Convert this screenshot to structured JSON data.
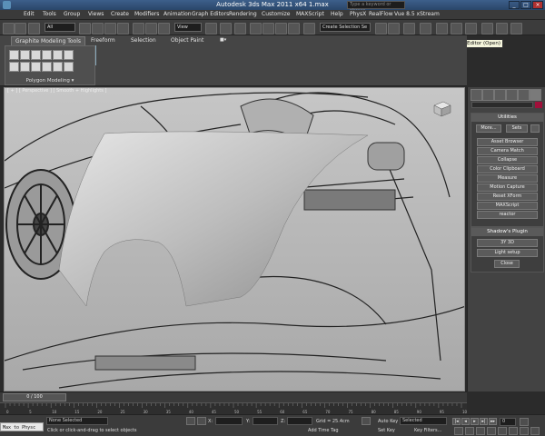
{
  "window": {
    "title": "Autodesk 3ds Max 2011 x64      1.max",
    "search_placeholder": "Type a keyword or phrase",
    "minimize": "_",
    "maximize": "□",
    "close": "×"
  },
  "menu": {
    "items": [
      "Edit",
      "Tools",
      "Group",
      "Views",
      "Create",
      "Modifiers",
      "Animation",
      "Graph Editors",
      "Rendering",
      "Customize",
      "MAXScript",
      "Help",
      "PhysX",
      "RealFlow",
      "Vue 8.5 xStream"
    ]
  },
  "toolbar": {
    "selection_filter": "All",
    "ref_coord": "View",
    "named_selection": "Create Selection Se",
    "tooltip": "Curve Editor (Open)"
  },
  "ribbon": {
    "tabs": [
      "Graphite Modeling Tools",
      "Freeform",
      "Selection",
      "Object Paint"
    ],
    "panel_label": "Polygon Modeling ▾"
  },
  "viewport": {
    "label": "[ + ] [ Perspective ] [ Smooth + Highlights ]"
  },
  "command_panel": {
    "utilities_title": "Utilities",
    "more_label": "More...",
    "sets_label": "Sets",
    "utility_buttons": [
      "Asset Browser",
      "Camera Match",
      "Collapse",
      "Color Clipboard",
      "Measure",
      "Motion Capture",
      "Reset XForm",
      "MAXScript",
      "reactor"
    ],
    "plugin_title": "Shadow's Plugin",
    "plugin_buttons": [
      "3Y 3D",
      "Light setup"
    ],
    "close_label": "Close"
  },
  "timeline": {
    "frame_label": "0 / 100",
    "ticks": [
      "0",
      "5",
      "10",
      "15",
      "20",
      "25",
      "30",
      "35",
      "40",
      "45",
      "50",
      "55",
      "60",
      "65",
      "70",
      "75",
      "80",
      "85",
      "90",
      "95",
      "100"
    ]
  },
  "status": {
    "maxscript_text": "Max to Physc",
    "selection": "None Selected",
    "prompt": "Click or click-and-drag to select objects",
    "x_label": "X:",
    "y_label": "Y:",
    "z_label": "Z:",
    "grid": "Grid = 25.4cm",
    "auto_key": "Auto Key",
    "set_key": "Set Key",
    "key_mode": "Selected",
    "key_filters": "Key Filters...",
    "add_time_tag": "Add Time Tag",
    "frame_value": "0"
  }
}
